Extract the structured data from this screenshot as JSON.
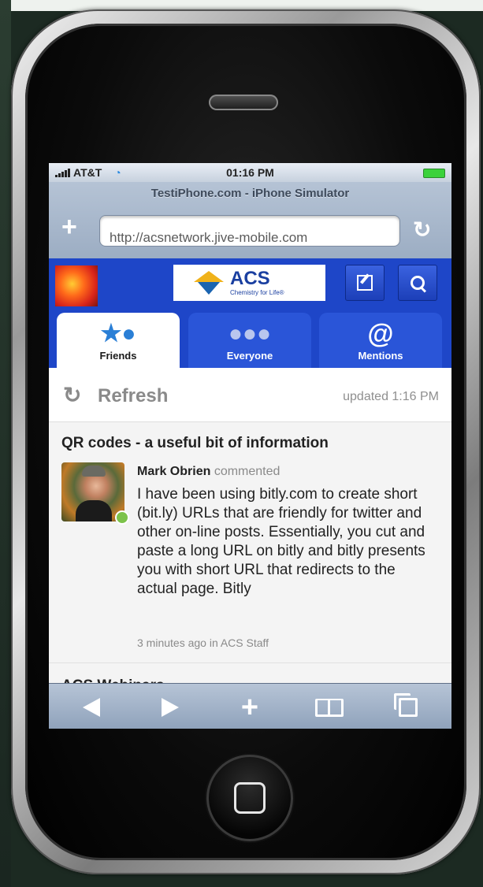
{
  "status_bar": {
    "carrier": "AT&T",
    "time": "01:16 PM"
  },
  "browser": {
    "page_title": "TestiPhone.com - iPhone Simulator",
    "url": "http://acsnetwork.jive-mobile.com"
  },
  "site_header": {
    "logo_title": "ACS",
    "logo_tagline": "Chemistry for Life®",
    "tabs": [
      {
        "label": "Friends",
        "icon": "friends-icon",
        "active": true
      },
      {
        "label": "Everyone",
        "icon": "everyone-icon",
        "active": false
      },
      {
        "label": "Mentions",
        "icon": "mentions-icon",
        "active": false
      }
    ]
  },
  "refresh": {
    "label": "Refresh",
    "updated": "updated 1:16 PM"
  },
  "post": {
    "title": "QR codes - a useful bit of information",
    "author": "Mark Obrien",
    "action": "commented",
    "body": "I have been using bitly.com to create short (bit.ly) URLs that are friendly for twitter and other on-line posts. Essentially, you cut and paste a long URL on bitly and bitly presents you with short URL that redirects to the actual page.  Bitly",
    "meta": "3 minutes ago in ACS Staff"
  },
  "next_post": {
    "title": "ACS Webinars"
  },
  "colors": {
    "header_blue": "#1e46c8",
    "tab_blue": "#2a55d8",
    "chrome": "#9cadc3"
  },
  "mentions_glyph": "@"
}
